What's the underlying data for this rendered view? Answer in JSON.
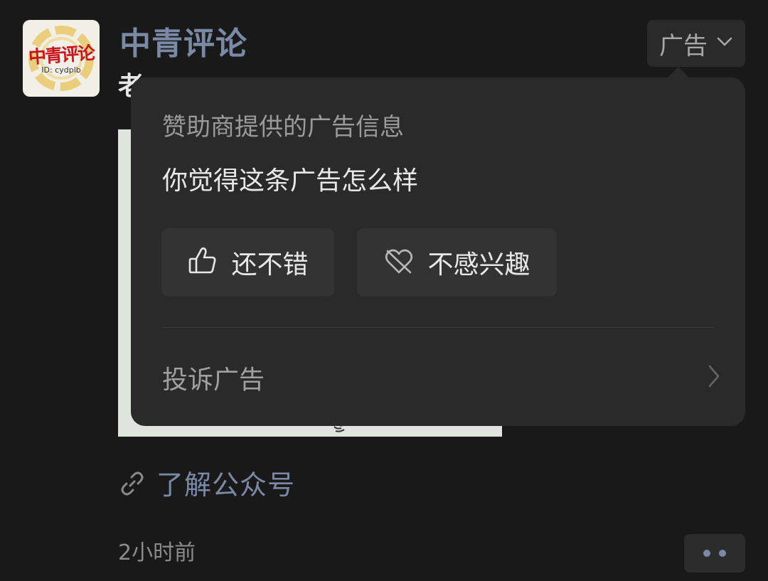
{
  "account": {
    "name": "中青评论",
    "logo_text": "中青评论",
    "logo_id": "ID: cydplb"
  },
  "post": {
    "text_visible": "老"
  },
  "ad_tag": {
    "label": "广告",
    "icon": "chevron-down-icon"
  },
  "popup": {
    "title": "赞助商提供的广告信息",
    "question": "你觉得这条广告怎么样",
    "buttons": [
      {
        "label": "还不错",
        "icon": "thumbs-up-icon"
      },
      {
        "label": "不感兴趣",
        "icon": "heart-crossed-icon"
      }
    ],
    "complaint": {
      "label": "投诉广告",
      "icon": "chevron-right-icon"
    }
  },
  "link": {
    "label": "了解公众号",
    "icon": "link-icon"
  },
  "timestamp": "2小时前",
  "more_button": {
    "icon": "more-dots-icon"
  },
  "colors": {
    "background": "#191919",
    "popup": "#2a2a2a",
    "accent_link": "#7a8aa6",
    "logo_red": "#c8161d"
  }
}
